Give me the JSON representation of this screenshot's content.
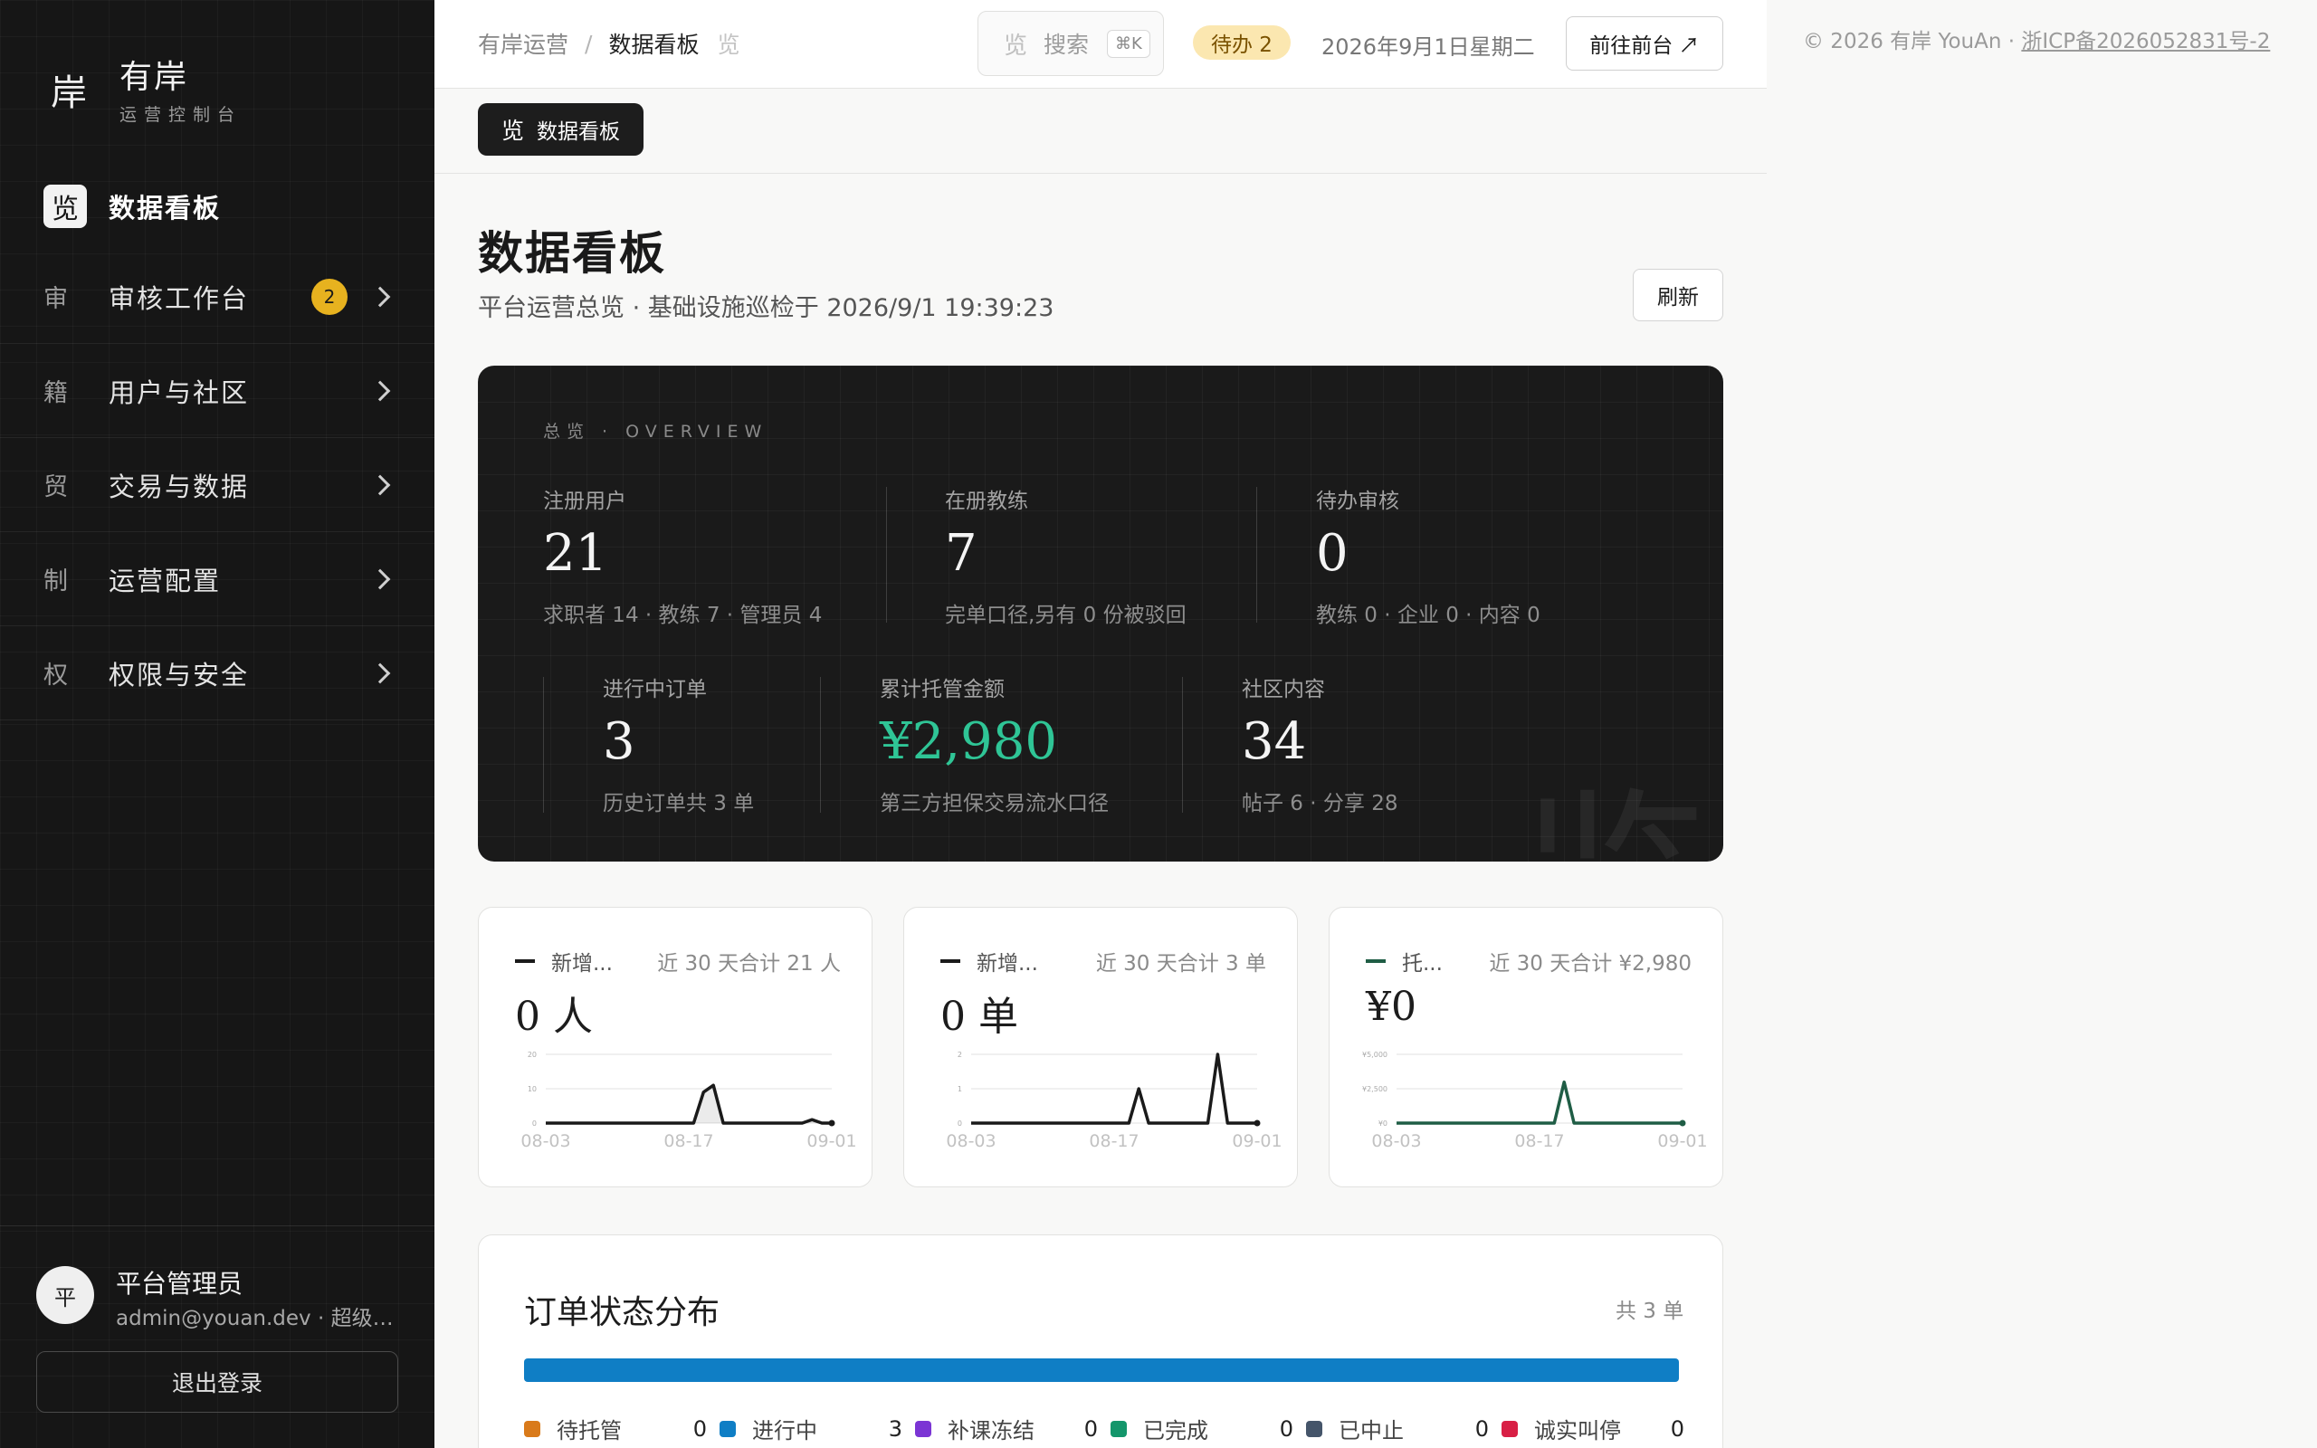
{
  "sidebar": {
    "brand_mark": "岸",
    "brand_name": "有岸",
    "brand_sub": "运营控制台",
    "items": [
      {
        "icon": "览",
        "label": "数据看板",
        "active": true
      },
      {
        "icon": "审",
        "label": "审核工作台",
        "badge": "2"
      },
      {
        "icon": "籍",
        "label": "用户与社区"
      },
      {
        "icon": "贸",
        "label": "交易与数据"
      },
      {
        "icon": "制",
        "label": "运营配置"
      },
      {
        "icon": "权",
        "label": "权限与安全"
      }
    ],
    "user": {
      "avatar": "平",
      "name": "平台管理员",
      "meta": "admin@youan.dev · 超级管理员",
      "logout": "退出登录"
    }
  },
  "topbar": {
    "crumbs": [
      "有岸运营",
      "数据看板"
    ],
    "crumb_sep": "/",
    "crumb_icon": "览",
    "search_icon": "览",
    "search_label": "搜索",
    "search_kbd": "⌘K",
    "todo": "待办 2",
    "date": "2026年9月1日星期二",
    "go_front": "前往前台 ↗"
  },
  "tab": {
    "icon": "览",
    "label": "数据看板"
  },
  "page": {
    "title": "数据看板",
    "subtitle": "平台运营总览 · 基础设施巡检于 2026/9/1 19:39:23",
    "refresh": "刷新"
  },
  "overview": {
    "label": "总览 · OVERVIEW",
    "watermark": "览",
    "stats": [
      {
        "label": "注册用户",
        "value": "21",
        "note": "求职者 14 · 教练 7 · 管理员 4"
      },
      {
        "label": "在册教练",
        "value": "7",
        "note": "完单口径,另有 0 份被驳回"
      },
      {
        "label": "待办审核",
        "value": "0",
        "note": "教练 0 · 企业 0 · 内容 0"
      },
      {
        "label": "进行中订单",
        "value": "3",
        "note": "历史订单共 3 单"
      },
      {
        "label": "累计托管金额",
        "value": "¥2,980",
        "note": "第三方担保交易流水口径"
      },
      {
        "label": "社区内容",
        "value": "34",
        "note": "帖子 6 · 分享 28"
      }
    ]
  },
  "minis": [
    {
      "legend": "新增...",
      "total": "近 30 天合计 21 人",
      "value": "0 人",
      "color": "#1a1a1a",
      "yticks": [
        "20",
        "10",
        "0"
      ],
      "xticks": [
        "08-03",
        "08-17",
        "09-01"
      ]
    },
    {
      "legend": "新增...",
      "total": "近 30 天合计 3 单",
      "value": "0 单",
      "color": "#1a1a1a",
      "yticks": [
        "2",
        "1",
        "0"
      ],
      "xticks": [
        "08-03",
        "08-17",
        "09-01"
      ]
    },
    {
      "legend": "托...",
      "total": "近 30 天合计 ¥2,980",
      "value": "¥0",
      "color": "#1f5d45",
      "yticks": [
        "¥5,000",
        "¥2,500",
        "¥0"
      ],
      "xticks": [
        "08-03",
        "08-17",
        "09-01"
      ]
    }
  ],
  "chart_data": [
    {
      "type": "area",
      "series": [
        {
          "values": [
            0,
            0,
            0,
            0,
            0,
            0,
            0,
            0,
            0,
            0,
            0,
            0,
            0,
            0,
            0,
            0,
            9,
            11,
            0,
            0,
            0,
            0,
            0,
            0,
            0,
            0,
            0,
            1,
            0,
            0
          ]
        }
      ],
      "ylim": [
        0,
        20
      ]
    },
    {
      "type": "line",
      "series": [
        {
          "values": [
            0,
            0,
            0,
            0,
            0,
            0,
            0,
            0,
            0,
            0,
            0,
            0,
            0,
            0,
            0,
            0,
            0,
            1,
            0,
            0,
            0,
            0,
            0,
            0,
            0,
            2,
            0,
            0,
            0,
            0
          ]
        }
      ],
      "ylim": [
        0,
        2
      ]
    },
    {
      "type": "line",
      "series": [
        {
          "values": [
            0,
            0,
            0,
            0,
            0,
            0,
            0,
            0,
            0,
            0,
            0,
            0,
            0,
            0,
            0,
            0,
            0,
            2980,
            0,
            0,
            0,
            0,
            0,
            0,
            0,
            0,
            0,
            0,
            0,
            0
          ]
        }
      ],
      "ylim": [
        0,
        5000
      ]
    }
  ],
  "orders": {
    "title": "订单状态分布",
    "count": "共 3 单",
    "items": [
      {
        "label": "待托管",
        "value": "0",
        "color": "#d97a1a"
      },
      {
        "label": "进行中",
        "value": "3",
        "color": "#0f7ec5"
      },
      {
        "label": "补课冻结",
        "value": "0",
        "color": "#7b35d4"
      },
      {
        "label": "已完成",
        "value": "0",
        "color": "#14966b"
      },
      {
        "label": "已中止",
        "value": "0",
        "color": "#45556a"
      },
      {
        "label": "诚实叫停",
        "value": "0",
        "color": "#d81f45"
      }
    ]
  },
  "footer": {
    "copyright": "© 2026 有岸 YouAn · ",
    "icp": "浙ICP备2026052831号-2"
  }
}
